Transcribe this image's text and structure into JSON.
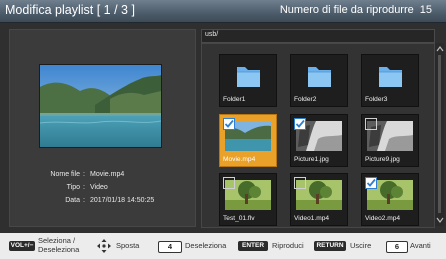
{
  "header": {
    "title": "Modifica playlist",
    "page_indicator": "[ 1 / 3 ]",
    "file_count_label": "Numero di file da riprodurre",
    "file_count": "15"
  },
  "info": {
    "rows": [
      {
        "label": "Nome file",
        "value": "Movie.mp4"
      },
      {
        "label": "Tipo",
        "value": "Video"
      },
      {
        "label": "Data",
        "value": "2017/01/18  14:50:25"
      }
    ]
  },
  "browser": {
    "path": "usb/",
    "tiles": [
      {
        "label": "Folder1",
        "kind": "folder",
        "checked": false,
        "selected": false
      },
      {
        "label": "Folder2",
        "kind": "folder",
        "checked": false,
        "selected": false
      },
      {
        "label": "Folder3",
        "kind": "folder",
        "checked": false,
        "selected": false
      },
      {
        "label": "Movie.mp4",
        "kind": "lake-image",
        "checked": true,
        "selected": true
      },
      {
        "label": "Picture1.jpg",
        "kind": "bw-image",
        "checked": true,
        "selected": false
      },
      {
        "label": "Picture9.jpg",
        "kind": "bw-image",
        "checked": false,
        "selected": false
      },
      {
        "label": "Test_01.flv",
        "kind": "tree-image",
        "checked": false,
        "selected": false
      },
      {
        "label": "Video1.mp4",
        "kind": "tree-image",
        "checked": false,
        "selected": false
      },
      {
        "label": "Video2.mp4",
        "kind": "tree-image",
        "checked": true,
        "selected": false
      }
    ]
  },
  "footer": {
    "vol_key": "VOL+/−",
    "select_label_1": "Seleziona /",
    "select_label_2": "Deseleziona",
    "move_label": "Sposta",
    "key_4": "4",
    "deselect_label": "Deseleziona",
    "enter_key": "ENTER",
    "play_label": "Riproduci",
    "return_key": "RETURN",
    "exit_label": "Uscire",
    "key_6": "6",
    "next_label": "Avanti"
  },
  "colors": {
    "selection": "#e9a12a",
    "folder": "#6ab0ec",
    "check": "#2f7fd0"
  },
  "icons": [
    "folder-icon",
    "checkbox-checked-icon",
    "checkbox-empty-icon",
    "dpad-icon",
    "scroll-up-icon",
    "scroll-down-icon"
  ]
}
